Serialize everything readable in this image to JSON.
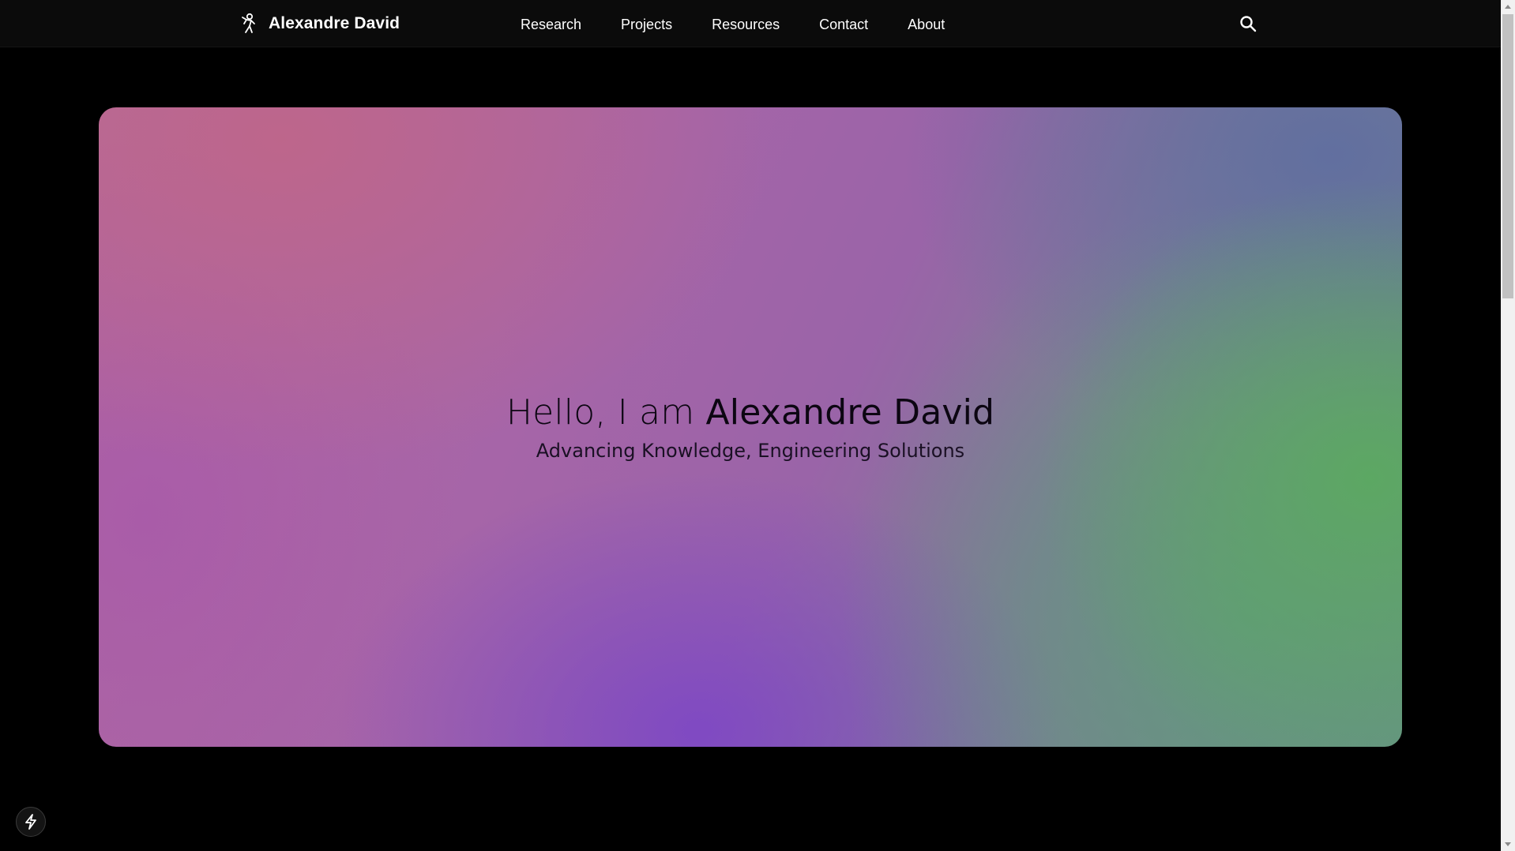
{
  "header": {
    "brand": {
      "name": "Alexandre David",
      "icon": "walking-figure-logo-icon"
    },
    "nav": [
      {
        "label": "Research"
      },
      {
        "label": "Projects"
      },
      {
        "label": "Resources"
      },
      {
        "label": "Contact"
      },
      {
        "label": "About"
      }
    ],
    "search_icon": "search-icon"
  },
  "hero": {
    "greeting": "Hello, I am ",
    "name": "Alexandre David",
    "subtitle": "Advancing Knowledge, Engineering Solutions",
    "gradient_colors": [
      "#bb6a93",
      "#a462a8",
      "#864cbf",
      "#6878a0",
      "#5fa36a"
    ]
  },
  "floating_button": {
    "icon": "lightning-bolt-icon"
  },
  "colors": {
    "background": "#000000",
    "navbar": "#0b0b0b",
    "nav_text": "#ffffff",
    "hero_text": "#0c0612"
  }
}
